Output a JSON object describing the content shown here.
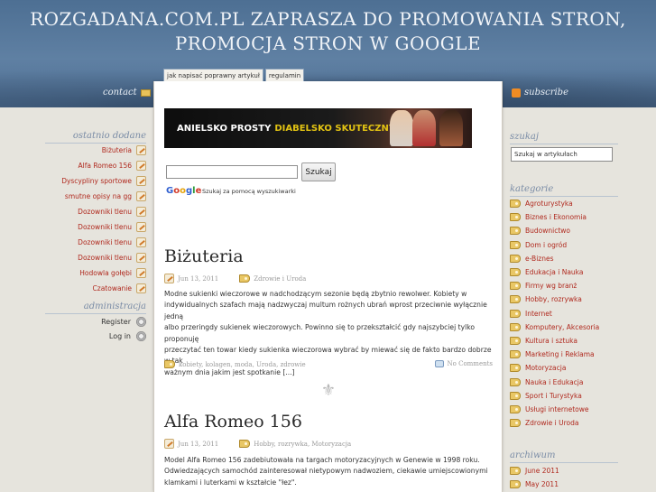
{
  "header": {
    "title_line1": "ROZGADANA.COM.PL ZAPRASZA DO PROMOWANIA STRON,",
    "title_line2": "PROMOCJA STRON W GOOGLE",
    "contact_label": "contact",
    "subscribe_label": "subscribe",
    "tabs": [
      "jak napisać poprawny artykuł",
      "regulamin"
    ]
  },
  "left_sidebar": {
    "recent_heading": "ostatnio dodane",
    "recent_items": [
      "Biżuteria",
      "Alfa Romeo 156",
      "Dyscypliny sportowe",
      "smutne opisy na gg",
      "Dozowniki tlenu",
      "Dozowniki tlenu",
      "Dozowniki tlenu",
      "Dozowniki tlenu",
      "Hodowla gołębi",
      "Czatowanie"
    ],
    "admin_heading": "administracja",
    "admin_items": [
      "Register",
      "Log in"
    ]
  },
  "right_sidebar": {
    "search_heading": "szukaj",
    "search_value": "Szukaj w artykułach",
    "categories_heading": "kategorie",
    "categories": [
      "Agroturystyka",
      "Biznes i Ekonomia",
      "Budownictwo",
      "Dom i ogród",
      "e-Biznes",
      "Edukacja i Nauka",
      "Firmy wg branż",
      "Hobby, rozrywka",
      "Internet",
      "Komputery, Akcesoria",
      "Kultura i sztuka",
      "Marketing i Reklama",
      "Motoryzacja",
      "Nauka i Edukacja",
      "Sport i Turystyka",
      "Usługi internetowe",
      "Zdrowie i Uroda"
    ],
    "archive_heading": "archiwum",
    "archive_items": [
      "June 2011",
      "May 2011"
    ]
  },
  "banner": {
    "text_white": "ANIELSKO PROSTY",
    "text_yellow": "DIABELSKO SKUTECZNY"
  },
  "google_search": {
    "button_label": "Szukaj",
    "caption": "Szukaj za pomocą wyszukiwarki"
  },
  "posts": [
    {
      "title": "Biżuteria",
      "date": "Jun 13, 2011",
      "category": "Zdrowie i Uroda",
      "excerpt": [
        "Modne sukienki wieczorowe w nadchodzącym sezonie będą zbytnio rewolwer. Kobiety w",
        "indywidualnych szafach mają nadzwyczaj multum rożnych ubrań wprost przeciwnie wyłącznie jedną",
        "albo przeringdy sukienek wieczorowych. Powinno się to przekształcić gdy najszybciej tylko proponuję",
        "przeczytać ten towar kiedy sukienka wieczorowa wybrać by miewać się de fakto bardzo dobrze w tak",
        "ważnym dnia jakim jest spotkanie [...]"
      ],
      "tags": "kobiety, kolagen, moda, Uroda, zdrowie",
      "comments": "No Comments"
    },
    {
      "title": "Alfa Romeo 156",
      "date": "Jun 13, 2011",
      "category": "Hobby, rozrywka, Motoryzacja",
      "excerpt": [
        "Model Alfa Romeo 156 zadebiutowała na targach motoryzacyjnych w Genewie w 1998 roku.",
        "Odwiedzających samochód zainteresował nietypowym nadwoziem, ciekawie umiejscowionymi",
        "klamkami i luterkami w kształcie \"łez\"."
      ]
    }
  ],
  "colors": {
    "header_blue": "#5f80a3",
    "link_red": "#b0291e",
    "heading_blue": "#7a8ca6",
    "page_bg": "#e6e4dd"
  }
}
